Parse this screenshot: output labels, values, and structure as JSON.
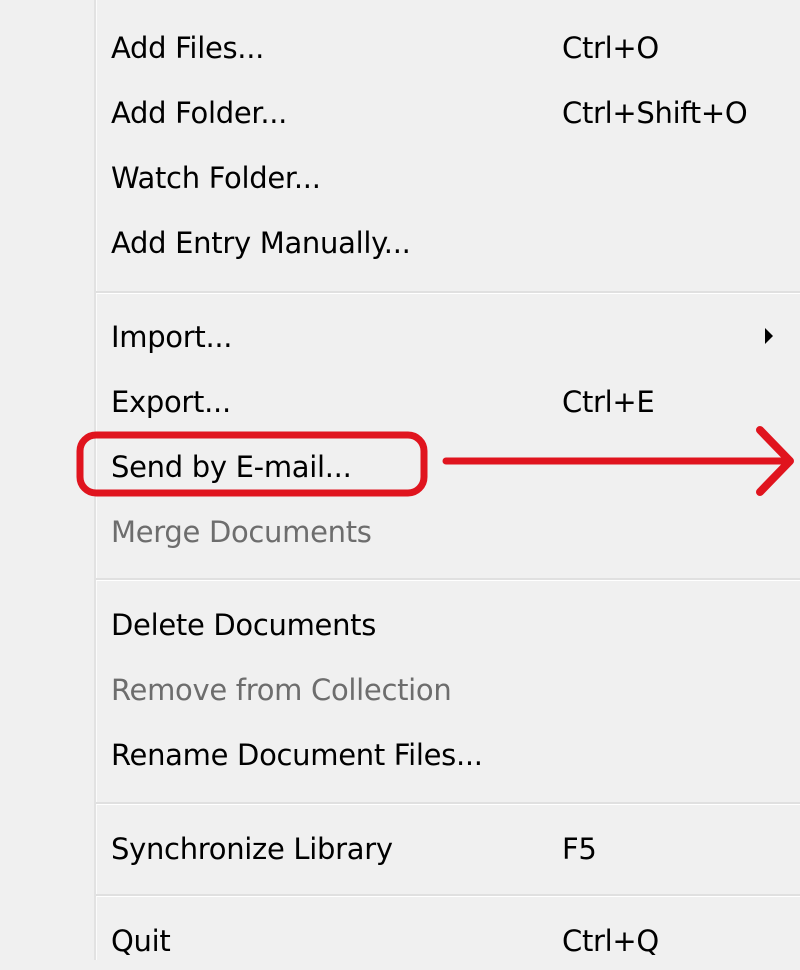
{
  "menu": {
    "items": [
      {
        "label": "Add Files...",
        "shortcut": "Ctrl+O",
        "enabled": true
      },
      {
        "label": "Add Folder...",
        "shortcut": "Ctrl+Shift+O",
        "enabled": true
      },
      {
        "label": "Watch Folder...",
        "shortcut": "",
        "enabled": true
      },
      {
        "label": "Add Entry Manually...",
        "shortcut": "",
        "enabled": true
      },
      {
        "label": "Import...",
        "shortcut": "",
        "enabled": true,
        "submenu": true
      },
      {
        "label": "Export...",
        "shortcut": "Ctrl+E",
        "enabled": true
      },
      {
        "label": "Send by E-mail...",
        "shortcut": "",
        "enabled": true,
        "highlighted_annotation": true
      },
      {
        "label": "Merge Documents",
        "shortcut": "",
        "enabled": false
      },
      {
        "label": "Delete Documents",
        "shortcut": "",
        "enabled": true
      },
      {
        "label": "Remove from Collection",
        "shortcut": "",
        "enabled": false
      },
      {
        "label": "Rename Document Files...",
        "shortcut": "",
        "enabled": true
      },
      {
        "label": "Synchronize Library",
        "shortcut": "F5",
        "enabled": true
      },
      {
        "label": "Quit",
        "shortcut": "Ctrl+Q",
        "enabled": true
      }
    ]
  },
  "annotation": {
    "color": "#e0141e",
    "shape": "rounded-rectangle-with-right-arrow",
    "target": "Send by E-mail..."
  },
  "colors": {
    "menu_background": "#f0f0f0",
    "disabled_text": "#6d6d6d",
    "separator": "#e0e0e0"
  },
  "icons": {
    "submenu_arrow": "triangle-right-icon"
  }
}
